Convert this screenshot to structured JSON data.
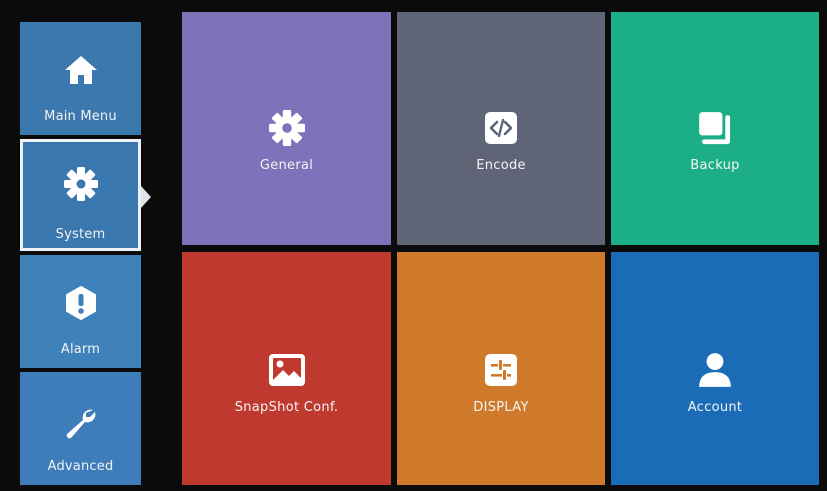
{
  "sidebar": {
    "items": [
      {
        "label": "Main Menu",
        "icon": "home-icon",
        "color": "#3b78ad",
        "selected": false
      },
      {
        "label": "System",
        "icon": "gear-icon",
        "color": "#3a77ae",
        "selected": true
      },
      {
        "label": "Alarm",
        "icon": "alert-icon",
        "color": "#3f82bb",
        "selected": false
      },
      {
        "label": "Advanced",
        "icon": "wrench-icon",
        "color": "#3e7cba",
        "selected": false
      }
    ]
  },
  "tiles": [
    {
      "label": "General",
      "icon": "gear-icon",
      "color": "#7c73ba"
    },
    {
      "label": "Encode",
      "icon": "code-icon",
      "color": "#5f6477"
    },
    {
      "label": "Backup",
      "icon": "backup-icon",
      "color": "#1cae86"
    },
    {
      "label": "SnapShot Conf.",
      "icon": "image-icon",
      "color": "#c0392f"
    },
    {
      "label": "DISPLAY",
      "icon": "sliders-icon",
      "color": "#cf7a2a"
    },
    {
      "label": "Account",
      "icon": "user-icon",
      "color": "#1b6cb6"
    }
  ]
}
